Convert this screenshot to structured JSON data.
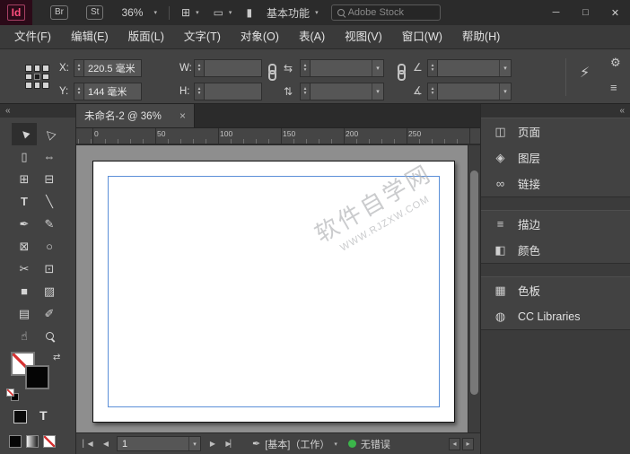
{
  "titlebar": {
    "app_logo": "Id",
    "bridge": "Br",
    "stock": "St",
    "zoom": "36%",
    "workspace": "基本功能",
    "search_placeholder": "Adobe Stock"
  },
  "menu": [
    "文件(F)",
    "编辑(E)",
    "版面(L)",
    "文字(T)",
    "对象(O)",
    "表(A)",
    "视图(V)",
    "窗口(W)",
    "帮助(H)"
  ],
  "control_panel": {
    "x_label": "X:",
    "x_value": "220.5 毫米",
    "y_label": "Y:",
    "y_value": "144 毫米",
    "w_label": "W:",
    "w_value": "",
    "h_label": "H:",
    "h_value": ""
  },
  "tab": {
    "title": "未命名-2 @ 36%",
    "close": "×"
  },
  "ruler_ticks": [
    "0",
    "50",
    "100",
    "150",
    "200",
    "250"
  ],
  "watermark": {
    "line1": "软件自学网",
    "line2": "WWW.RJZXW.COM"
  },
  "tools": [
    {
      "icon": "selection-tool-icon",
      "glyph": "►"
    },
    {
      "icon": "direct-selection-tool-icon",
      "glyph": "▷"
    },
    {
      "icon": "page-tool-icon",
      "glyph": "▯"
    },
    {
      "icon": "gap-tool-icon",
      "glyph": "⇔"
    },
    {
      "icon": "content-collector-tool-icon",
      "glyph": "⊞"
    },
    {
      "icon": "content-placer-tool-icon",
      "glyph": "⊟"
    },
    {
      "icon": "type-tool-icon",
      "glyph": "T"
    },
    {
      "icon": "line-tool-icon",
      "glyph": "╲"
    },
    {
      "icon": "pen-tool-icon",
      "glyph": "✒"
    },
    {
      "icon": "pencil-tool-icon",
      "glyph": "✎"
    },
    {
      "icon": "rectangle-frame-tool-icon",
      "glyph": "⊠"
    },
    {
      "icon": "ellipse-frame-tool-icon",
      "glyph": "○"
    },
    {
      "icon": "scissors-tool-icon",
      "glyph": "✂"
    },
    {
      "icon": "free-transform-tool-icon",
      "glyph": "⊡"
    },
    {
      "icon": "gradient-swatch-tool-icon",
      "glyph": "■"
    },
    {
      "icon": "gradient-feather-tool-icon",
      "glyph": "▨"
    },
    {
      "icon": "note-tool-icon",
      "glyph": "▤"
    },
    {
      "icon": "eyedropper-tool-icon",
      "glyph": "✐"
    },
    {
      "icon": "hand-tool-icon",
      "glyph": "☝"
    },
    {
      "icon": "zoom-tool-icon",
      "glyph": ""
    }
  ],
  "right_panel": {
    "groups": [
      [
        {
          "icon": "pages-icon",
          "glyph": "◫",
          "label": "页面"
        },
        {
          "icon": "layers-icon",
          "glyph": "◈",
          "label": "图层"
        },
        {
          "icon": "links-icon",
          "glyph": "∞",
          "label": "链接"
        }
      ],
      [
        {
          "icon": "stroke-icon",
          "glyph": "≡",
          "label": "描边"
        },
        {
          "icon": "color-icon",
          "glyph": "◧",
          "label": "颜色"
        }
      ],
      [
        {
          "icon": "swatches-icon",
          "glyph": "▦",
          "label": "色板"
        },
        {
          "icon": "cc-libraries-icon",
          "glyph": "◍",
          "label": "CC Libraries"
        }
      ]
    ]
  },
  "statusbar": {
    "page_number": "1",
    "preflight_profile": "[基本]（工作）",
    "preflight_status": "无错误",
    "status_color": "#3bb54a"
  },
  "icons": {
    "chevron_down": "▾",
    "spinner": "▴\n▾",
    "view_options": "⊞",
    "screen_mode": "▭",
    "arrange_documents": "▮",
    "minimize": "─",
    "maximize": "□",
    "close": "✕",
    "collapse_panels": "«",
    "flip_horizontal": "⇆",
    "flip_vertical": "⇅",
    "rotation_angle": "∠",
    "shear_angle": "∡",
    "quick_apply": "⚡",
    "gear": "⚙",
    "panel_menu": "≡",
    "nav_first": "▏◀",
    "nav_prev": "◀",
    "nav_next": "▶",
    "nav_last": "▶▏",
    "preflight_pen": "✒",
    "hscroll_left": "◂",
    "hscroll_right": "▸",
    "swap_fill_stroke": "⇄",
    "formatting_text": "T"
  }
}
